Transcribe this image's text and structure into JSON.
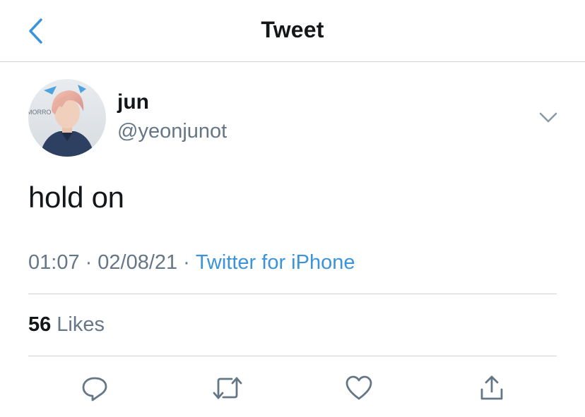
{
  "header": {
    "title": "Tweet",
    "back_icon": "chevron-left-icon"
  },
  "tweet": {
    "author_name": "jun",
    "author_handle": "@yeonjunot",
    "avatar_text": "MORRO",
    "text": "hold on",
    "time": "01:07",
    "date": "02/08/21",
    "separator": "·",
    "source": "Twitter for iPhone",
    "likes_count": "56",
    "likes_label": "Likes"
  },
  "actions": [
    "reply-icon",
    "retweet-icon",
    "like-icon",
    "share-icon"
  ],
  "colors": {
    "accent": "#3b94d9",
    "text": "#14171a",
    "secondary": "#657786",
    "divider": "#cfd4d9"
  }
}
